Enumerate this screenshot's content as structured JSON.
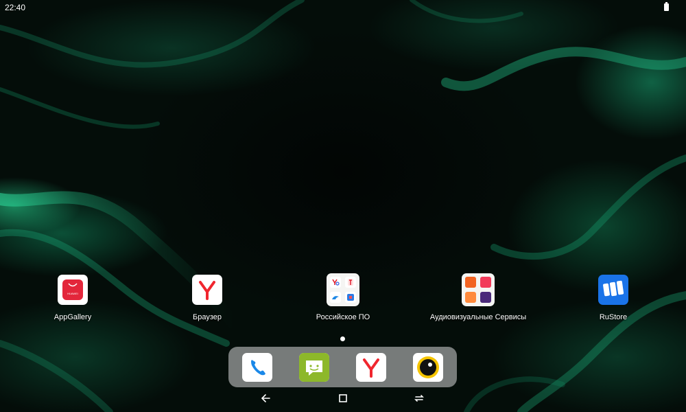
{
  "status_bar": {
    "time": "22:40"
  },
  "home": {
    "apps": [
      {
        "label": "AppGallery",
        "icon": "appgallery-icon",
        "brand_text": "HUAWEI"
      },
      {
        "label": "Браузер",
        "icon": "yandex-browser-icon"
      },
      {
        "label": "Российское ПО",
        "icon": "folder-icon"
      },
      {
        "label": "Аудиовизуальные Сервисы",
        "icon": "folder-icon"
      },
      {
        "label": "RuStore",
        "icon": "rustore-icon"
      }
    ],
    "page_indicator": {
      "pages": 1,
      "current": 1
    }
  },
  "dock": {
    "items": [
      {
        "name": "Phone",
        "icon": "phone-icon"
      },
      {
        "name": "Messaging",
        "icon": "messages-icon"
      },
      {
        "name": "Yandex Browser",
        "icon": "yandex-browser-icon"
      },
      {
        "name": "Camera",
        "icon": "camera-icon"
      }
    ]
  },
  "navigation": {
    "buttons": [
      "back-icon",
      "home-icon",
      "recents-icon"
    ]
  },
  "colors": {
    "accent": "#14a06e",
    "huawei_red": "#e3263b",
    "yandex_red": "#f0262e",
    "rustore_blue": "#1a73e8"
  }
}
